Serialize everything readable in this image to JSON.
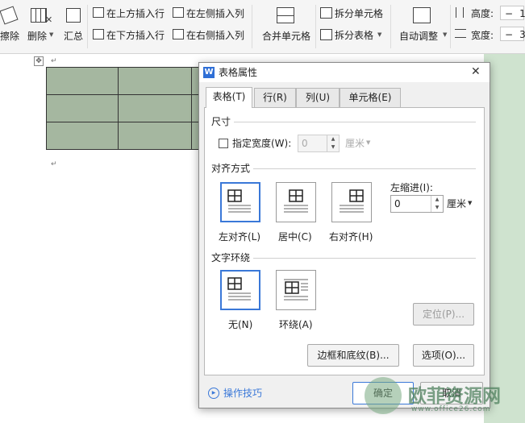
{
  "ribbon": {
    "erase_label": "擦除",
    "delete_label": "删除",
    "summary_label": "汇总",
    "insert_row_above": "在上方插入行",
    "insert_row_below": "在下方插入行",
    "insert_col_left": "在左侧插入列",
    "insert_col_right": "在右侧插入列",
    "merge_cells": "合并单元格",
    "split_cells": "拆分单元格",
    "split_table": "拆分表格",
    "auto_adjust": "自动调整",
    "height_label": "高度:",
    "width_label": "宽度:",
    "height_value": "1",
    "width_value": "3",
    "minus": "−"
  },
  "document": {
    "para_mark": "↵",
    "table_color": "#a5b7a0"
  },
  "dialog": {
    "title": "表格属性",
    "close": "✕",
    "tabs": [
      "表格(T)",
      "行(R)",
      "列(U)",
      "单元格(E)"
    ],
    "size_group": "尺寸",
    "specify_width_label": "指定宽度(W):",
    "width_value": "0",
    "width_unit": "厘米",
    "align_group": "对齐方式",
    "align_left": "左对齐(L)",
    "align_center": "居中(C)",
    "align_right": "右对齐(H)",
    "indent_label": "左缩进(I):",
    "indent_value": "0",
    "indent_unit": "厘米",
    "wrap_group": "文字环绕",
    "wrap_none": "无(N)",
    "wrap_around": "环绕(A)",
    "position_button": "定位(P)...",
    "borders_button": "边框和底纹(B)...",
    "options_button": "选项(O)...",
    "tips_link": "操作技巧",
    "ok_button": "确定",
    "cancel_button": "取消",
    "accent_color": "#3a78d8"
  },
  "watermark": {
    "text": "欧菲资源网",
    "url": "www.office26.com"
  }
}
